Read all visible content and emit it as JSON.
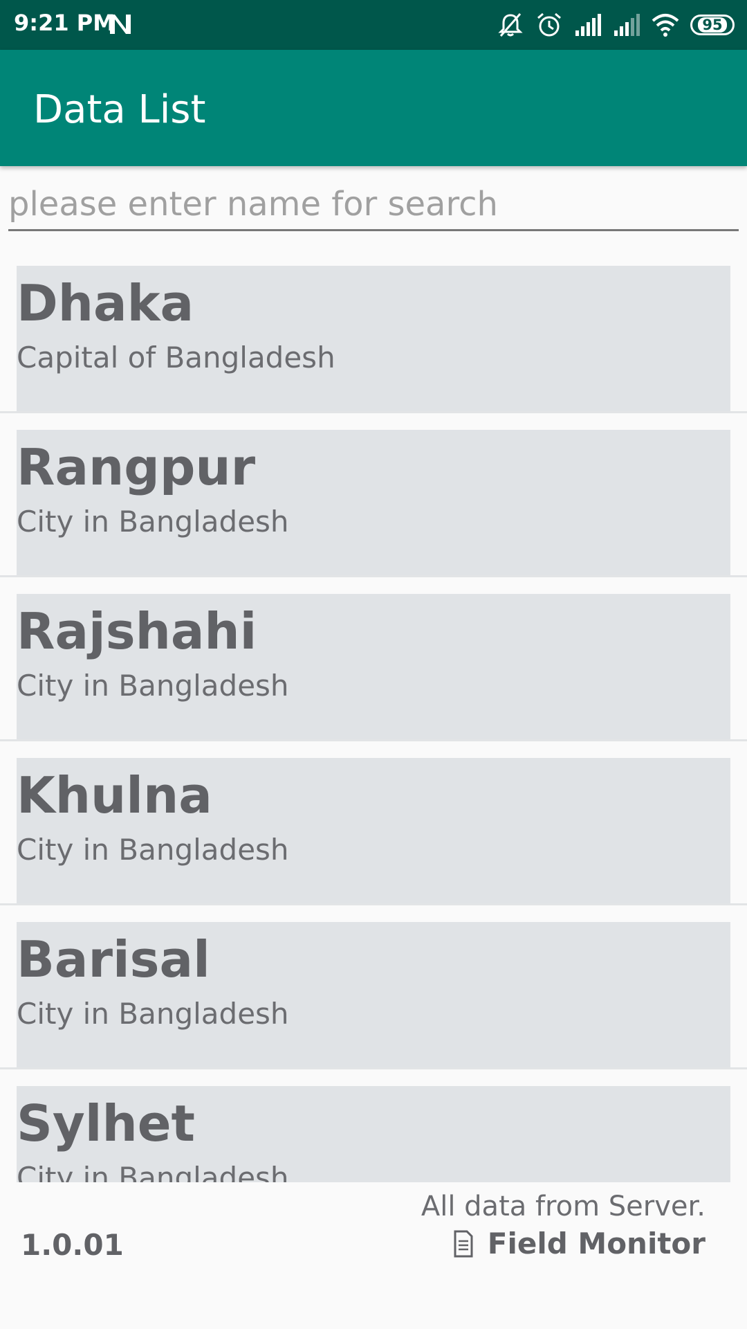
{
  "status_bar": {
    "time": "9:21 PM",
    "battery": "95",
    "icons": [
      "n-notification-icon",
      "bell-muted-icon",
      "alarm-icon",
      "signal-icon",
      "signal-icon-2",
      "wifi-icon",
      "battery-icon"
    ]
  },
  "app_bar": {
    "title": "Data List"
  },
  "search": {
    "placeholder": "please enter name for search",
    "value": ""
  },
  "items": [
    {
      "name": "Dhaka",
      "description": "Capital of Bangladesh"
    },
    {
      "name": "Rangpur",
      "description": "City in Bangladesh"
    },
    {
      "name": "Rajshahi",
      "description": "City in Bangladesh"
    },
    {
      "name": "Khulna",
      "description": "City in Bangladesh"
    },
    {
      "name": "Barisal",
      "description": "City in Bangladesh"
    },
    {
      "name": "Sylhet",
      "description": "City in Bangladesh"
    }
  ],
  "footer": {
    "note": "All data from Server.",
    "version": "1.0.01",
    "brand": "Field Monitor",
    "brand_icon": "document-icon"
  },
  "colors": {
    "status_bar": "#00574b",
    "app_bar": "#008577",
    "card": "#e0e3e6",
    "text": "#616266"
  }
}
